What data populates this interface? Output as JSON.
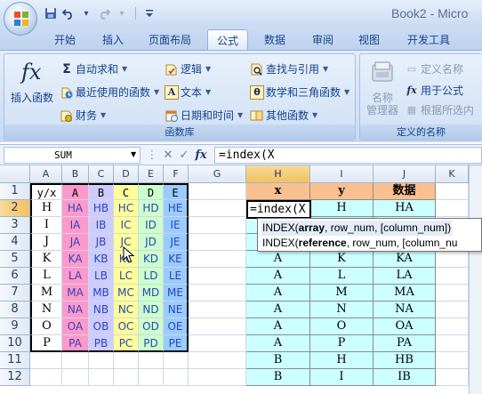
{
  "app": {
    "window_title": "Book2 - Micro",
    "quick_access": [
      {
        "name": "save-icon"
      },
      {
        "name": "undo-icon"
      },
      {
        "name": "redo-icon"
      },
      {
        "name": "customize-qat-icon"
      }
    ]
  },
  "tabs": [
    {
      "label": "开始",
      "active": false
    },
    {
      "label": "插入",
      "active": false
    },
    {
      "label": "页面布局",
      "active": false
    },
    {
      "label": "公式",
      "active": true
    },
    {
      "label": "数据",
      "active": false
    },
    {
      "label": "审阅",
      "active": false
    },
    {
      "label": "视图",
      "active": false
    },
    {
      "label": "开发工具",
      "active": false
    }
  ],
  "ribbon": {
    "function_library": {
      "label": "函数库",
      "insert_function": "插入函数",
      "autosum": "自动求和",
      "recent": "最近使用的函数",
      "financial": "财务",
      "logical": "逻辑",
      "text": "文本",
      "date_time": "日期和时间",
      "lookup": "查找与引用",
      "math": "数学和三角函数",
      "more": "其他函数"
    },
    "defined_names": {
      "label": "定义的名称",
      "name_manager_line1": "名称",
      "name_manager_line2": "管理器",
      "define_name": "定义名称",
      "use_in_formula": "用于公式",
      "create_from_selection": "根据所选内"
    }
  },
  "formula_bar": {
    "name_box": "SUM",
    "formula": "=index(X"
  },
  "grid": {
    "columns": [
      "A",
      "B",
      "C",
      "D",
      "E",
      "F",
      "G",
      "H",
      "I",
      "J",
      "K"
    ],
    "rows": [
      "1",
      "2",
      "3",
      "4",
      "5",
      "6",
      "7",
      "8",
      "9",
      "10",
      "11",
      "12"
    ],
    "header_row": [
      "y/x",
      "A",
      "B",
      "C",
      "D",
      "E"
    ],
    "table": [
      [
        "H",
        "HA",
        "HB",
        "HC",
        "HD",
        "HE"
      ],
      [
        "I",
        "IA",
        "IB",
        "IC",
        "ID",
        "IE"
      ],
      [
        "J",
        "JA",
        "JB",
        "JC",
        "JD",
        "JE"
      ],
      [
        "K",
        "KA",
        "KB",
        "KC",
        "KD",
        "KE"
      ],
      [
        "L",
        "LA",
        "LB",
        "LC",
        "LD",
        "LE"
      ],
      [
        "M",
        "MA",
        "MB",
        "MC",
        "MD",
        "ME"
      ],
      [
        "N",
        "NA",
        "NB",
        "NC",
        "ND",
        "NE"
      ],
      [
        "O",
        "OA",
        "OB",
        "OC",
        "OD",
        "OE"
      ],
      [
        "P",
        "PA",
        "PB",
        "PC",
        "PD",
        "PE"
      ]
    ],
    "right_headers": [
      "x",
      "y",
      "数据"
    ],
    "right_rows": [
      [
        "",
        "H",
        "HA"
      ],
      [
        "",
        "",
        ""
      ],
      [
        "",
        "",
        ""
      ],
      [
        "A",
        "K",
        "KA"
      ],
      [
        "A",
        "L",
        "LA"
      ],
      [
        "A",
        "M",
        "MA"
      ],
      [
        "A",
        "N",
        "NA"
      ],
      [
        "A",
        "O",
        "OA"
      ],
      [
        "A",
        "P",
        "PA"
      ],
      [
        "B",
        "H",
        "HB"
      ],
      [
        "B",
        "I",
        "IB"
      ]
    ],
    "active_cell_text": "=index(X",
    "colors": {
      "col_B": "#ff99cc",
      "col_C": "#ccccff",
      "col_D": "#ffff99",
      "col_E": "#ccffcc",
      "col_F": "#99ccff",
      "right_header": "#fac090",
      "right_body": "#ccffff"
    }
  },
  "tooltip": {
    "line1_prefix": "INDEX(",
    "line1_bold": "array",
    "line1_rest": ", row_num, [column_num])",
    "line2_prefix": "INDEX(",
    "line2_bold": "reference",
    "line2_rest": ", row_num, [column_nu"
  }
}
